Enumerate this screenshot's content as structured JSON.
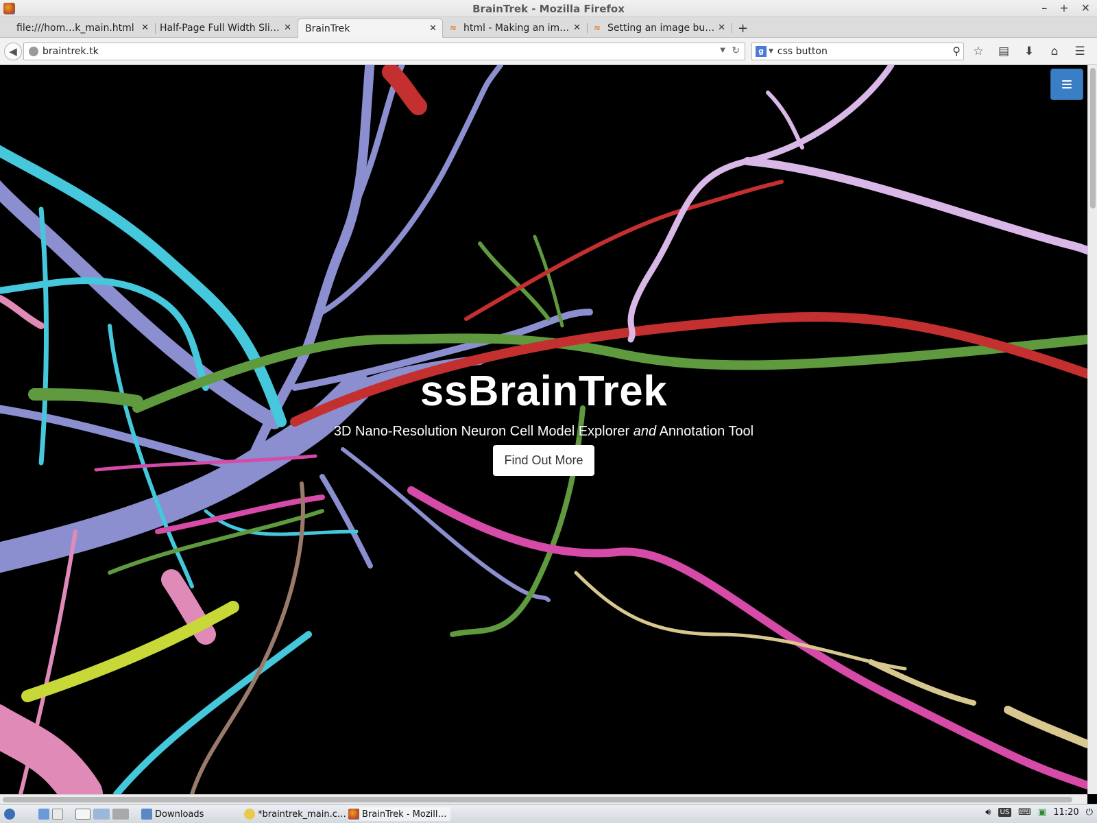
{
  "window": {
    "title": "BrainTrek - Mozilla Firefox",
    "controls": [
      "–",
      "+",
      "✕"
    ]
  },
  "tabs": [
    {
      "label": "file:///hom…k_main.html",
      "active": false,
      "favicon": "none"
    },
    {
      "label": "Half-Page Full Width Sli…",
      "active": false,
      "favicon": "none"
    },
    {
      "label": "BrainTrek",
      "active": true,
      "favicon": "none"
    },
    {
      "label": "html - Making an im…",
      "active": false,
      "favicon": "stackoverflow-icon"
    },
    {
      "label": "Setting an image bu…",
      "active": false,
      "favicon": "stackoverflow-icon"
    }
  ],
  "new_tab_label": "+",
  "navigation": {
    "url": "braintrek.tk",
    "search_engine_letter": "g",
    "search_query": "css button"
  },
  "hero": {
    "title": "ssBrainTrek",
    "subtitle_before": "3D Nano-Resolution Neuron Cell Model Explorer ",
    "subtitle_emphasis": "and",
    "subtitle_after": " Annotation Tool",
    "button_label": "Find Out More"
  },
  "colors": {
    "menu_toggle": "#3a7fc6",
    "background": "#000000",
    "neuron_palette": [
      "#8b8fd0",
      "#45c7dc",
      "#d64aa8",
      "#c43030",
      "#5f9a3e",
      "#c8d838",
      "#d9b8e8",
      "#9a7a6a",
      "#d8c890",
      "#e08ab8"
    ]
  },
  "taskbar": {
    "items": [
      {
        "label": "Downloads",
        "icon": "folder-icon"
      },
      {
        "label": "*braintrek_main.c…",
        "icon": "text-editor-icon"
      },
      {
        "label": "BrainTrek - Mozill…",
        "icon": "firefox-icon"
      }
    ],
    "keyboard_layout": "US",
    "clock": "11:20"
  }
}
